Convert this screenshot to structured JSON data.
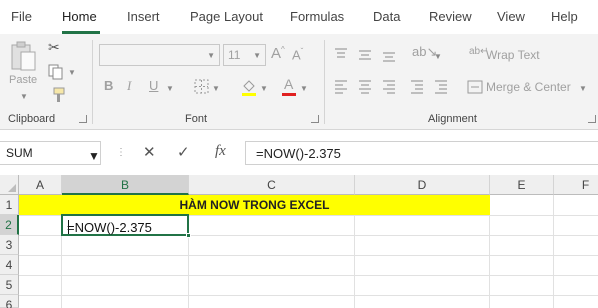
{
  "menu": {
    "items": [
      "File",
      "Home",
      "Insert",
      "Page Layout",
      "Formulas",
      "Data",
      "Review",
      "View",
      "Help"
    ],
    "active": "Home"
  },
  "ribbon": {
    "clipboard": {
      "label": "Clipboard",
      "paste_label": "Paste"
    },
    "font": {
      "label": "Font",
      "font_name": "",
      "font_size": "11",
      "bold": "B",
      "italic": "I",
      "underline": "U"
    },
    "alignment": {
      "label": "Alignment",
      "wrap_text": "Wrap Text",
      "merge_center": "Merge & Center"
    }
  },
  "formula_bar": {
    "name_box": "SUM",
    "cancel_glyph": "✕",
    "enter_glyph": "✓",
    "fx_glyph": "fx",
    "formula": "=NOW()-2.375"
  },
  "sheet": {
    "columns": [
      "A",
      "B",
      "C",
      "D",
      "E",
      "F"
    ],
    "rows": [
      "1",
      "2",
      "3",
      "4",
      "5",
      "6"
    ],
    "selected_column": "B",
    "selected_row": "2",
    "title_cell": "HÀM NOW TRONG EXCEL",
    "title_fill": "#ffff00",
    "active_cell_value": "=NOW()-2.375",
    "accent_color": "#217346"
  }
}
